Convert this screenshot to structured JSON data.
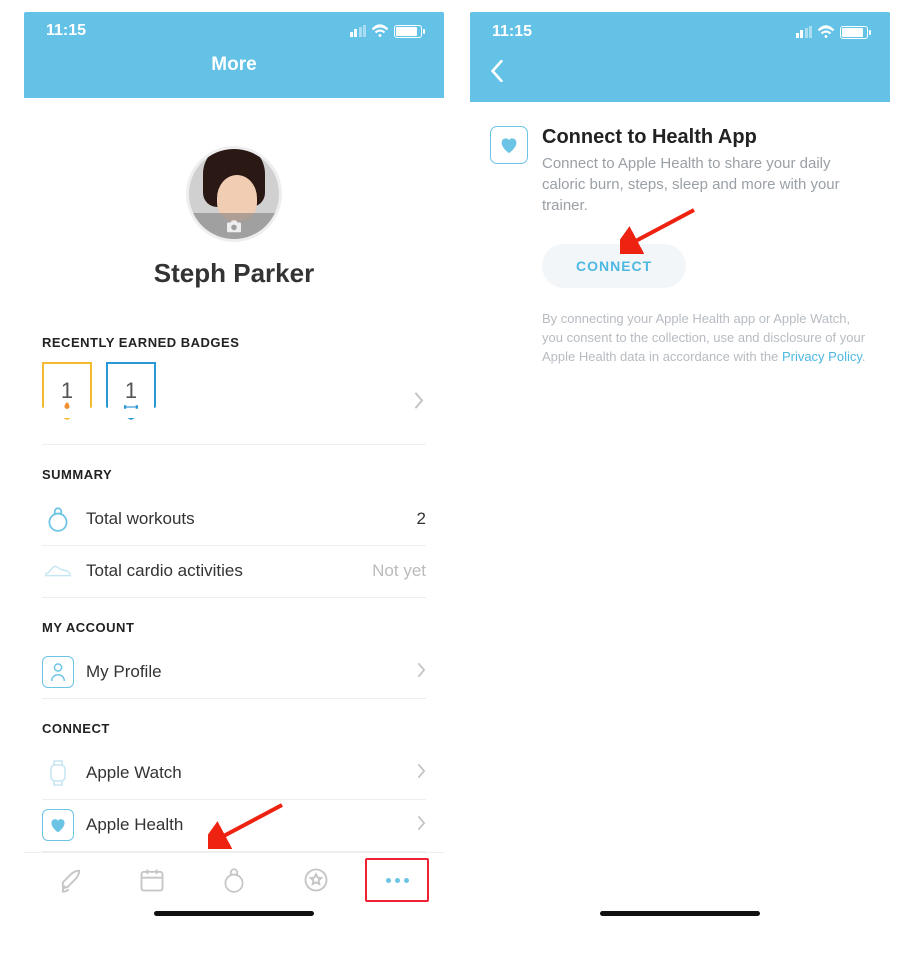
{
  "status": {
    "time": "11:15"
  },
  "screen1": {
    "title": "More",
    "user_name": "Steph Parker",
    "sections": {
      "badges_title": "RECENTLY EARNED BADGES",
      "badge1_value": "1",
      "badge2_value": "1",
      "summary_title": "SUMMARY",
      "summary": [
        {
          "label": "Total workouts",
          "value": "2",
          "muted": false
        },
        {
          "label": "Total cardio activities",
          "value": "Not yet",
          "muted": true
        }
      ],
      "account_title": "MY ACCOUNT",
      "account_item": "My Profile",
      "connect_title": "CONNECT",
      "connect": [
        {
          "label": "Apple Watch"
        },
        {
          "label": "Apple Health"
        }
      ]
    }
  },
  "screen2": {
    "title": "Connect to Health App",
    "description": "Connect to Apple Health to share your daily caloric burn, steps, sleep and more with your trainer.",
    "button": "CONNECT",
    "consent_pre": "By connecting your Apple Health app or Apple Watch, you consent to the collection, use and disclosure of your Apple Health data in accordance with the ",
    "privacy_link": "Privacy Policy",
    "consent_post": "."
  }
}
